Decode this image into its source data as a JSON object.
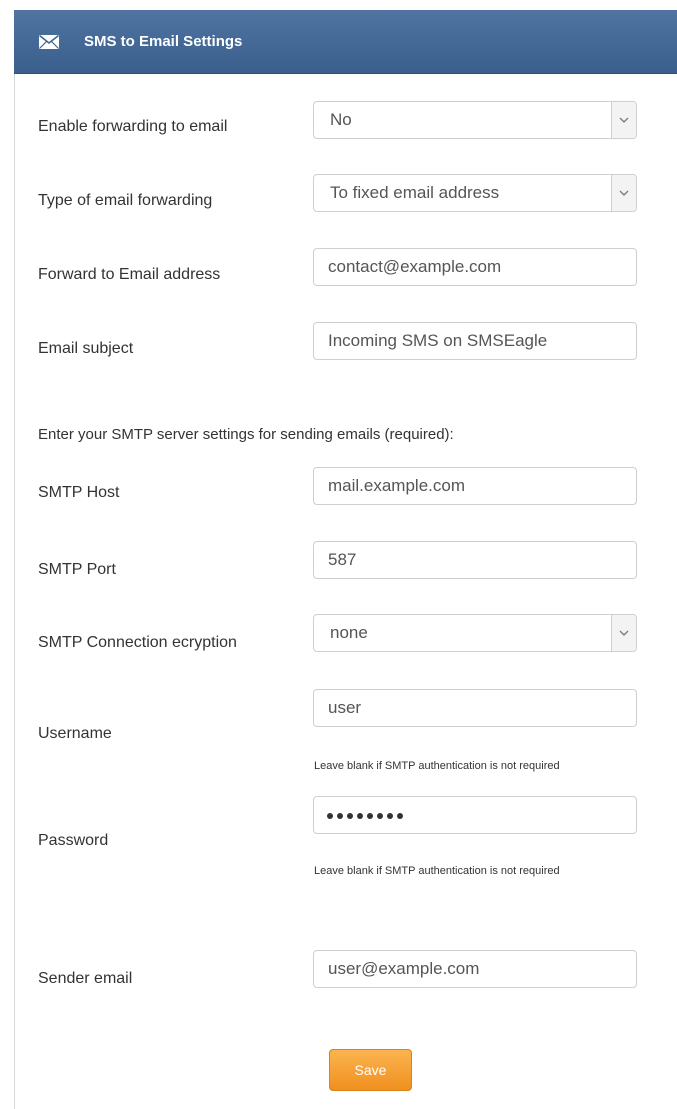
{
  "header": {
    "title": "SMS to Email Settings",
    "icon": "envelope-icon"
  },
  "form": {
    "enable_forwarding": {
      "label": "Enable forwarding to email",
      "value": "No"
    },
    "forwarding_type": {
      "label": "Type of email forwarding",
      "value": "To fixed email address"
    },
    "forward_to": {
      "label": "Forward to Email address",
      "value": "contact@example.com"
    },
    "email_subject": {
      "label": "Email subject",
      "value": "Incoming SMS on SMSEagle"
    },
    "smtp_note": "Enter your SMTP server settings for sending emails (required):",
    "smtp_host": {
      "label": "SMTP Host",
      "value": "mail.example.com"
    },
    "smtp_port": {
      "label": "SMTP Port",
      "value": "587"
    },
    "smtp_encryption": {
      "label": "SMTP Connection ecryption",
      "value": "none"
    },
    "username": {
      "label": "Username",
      "value": "user",
      "hint": "Leave blank if SMTP authentication is not required"
    },
    "password": {
      "label": "Password",
      "masked_length": 8,
      "hint": "Leave blank if SMTP authentication is not required"
    },
    "sender_email": {
      "label": "Sender email",
      "value": "user@example.com"
    },
    "save_label": "Save"
  },
  "colors": {
    "header_bg": "#3f6592",
    "save_bg": "#f4a035",
    "text": "#333333"
  }
}
